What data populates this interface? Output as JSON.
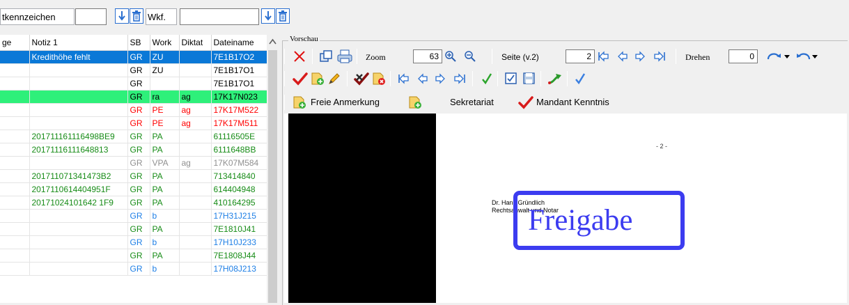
{
  "filters": {
    "field_label": "tkennzeichen",
    "field_value": "",
    "secondary_label": "Wkf.",
    "secondary_value": ""
  },
  "table": {
    "columns": [
      "ge",
      "Notiz 1",
      "SB",
      "Work",
      "Diktat",
      "Dateiname"
    ],
    "rows": [
      {
        "ge": "",
        "notiz": "Kredithöhe fehlt",
        "sb": "GR",
        "work": "ZU",
        "diktat": "",
        "datei": "7E1B17O2",
        "style": "selected"
      },
      {
        "ge": "",
        "notiz": "",
        "sb": "GR",
        "work": "ZU",
        "diktat": "",
        "datei": "7E1B17O1",
        "style": "black"
      },
      {
        "ge": "",
        "notiz": "",
        "sb": "GR",
        "work": "",
        "diktat": "",
        "datei": "7E1B17O1",
        "style": "black"
      },
      {
        "ge": "",
        "notiz": "",
        "sb": "GR",
        "work": "ra",
        "diktat": "ag",
        "datei": "17K17N023",
        "style": "green-bg"
      },
      {
        "ge": "",
        "notiz": "",
        "sb": "GR",
        "work": "PE",
        "diktat": "ag",
        "datei": "17K17M522",
        "style": "red"
      },
      {
        "ge": "",
        "notiz": "",
        "sb": "GR",
        "work": "PE",
        "diktat": "ag",
        "datei": "17K17M511",
        "style": "red"
      },
      {
        "ge": "",
        "notiz": "201711161116498BE9",
        "sb": "GR",
        "work": "PA",
        "diktat": "",
        "datei": "61116505E",
        "style": "green"
      },
      {
        "ge": "",
        "notiz": "20171116111648813",
        "sb": "GR",
        "work": "PA",
        "diktat": "",
        "datei": "6111648BB",
        "style": "green"
      },
      {
        "ge": "",
        "notiz": "",
        "sb": "GR",
        "work": "VPA",
        "diktat": "ag",
        "datei": "17K07M584",
        "style": "gray"
      },
      {
        "ge": "",
        "notiz": "201711071341473B2",
        "sb": "GR",
        "work": "PA",
        "diktat": "",
        "datei": "713414840",
        "style": "green"
      },
      {
        "ge": "",
        "notiz": "2017110614404951F",
        "sb": "GR",
        "work": "PA",
        "diktat": "",
        "datei": "614404948",
        "style": "green"
      },
      {
        "ge": "",
        "notiz": "20171024101642 1F9",
        "sb": "GR",
        "work": "PA",
        "diktat": "",
        "datei": "410164295",
        "style": "green"
      },
      {
        "ge": "",
        "notiz": "",
        "sb": "GR",
        "work": "b",
        "diktat": "",
        "datei": "17H31J215",
        "style": "blue"
      },
      {
        "ge": "",
        "notiz": "",
        "sb": "GR",
        "work": "PA",
        "diktat": "",
        "datei": "7E1810J41",
        "style": "green"
      },
      {
        "ge": "",
        "notiz": "",
        "sb": "GR",
        "work": "b",
        "diktat": "",
        "datei": "17H10J233",
        "style": "blue"
      },
      {
        "ge": "",
        "notiz": "",
        "sb": "GR",
        "work": "PA",
        "diktat": "",
        "datei": "7E1808J44",
        "style": "green"
      },
      {
        "ge": "",
        "notiz": "",
        "sb": "GR",
        "work": "b",
        "diktat": "",
        "datei": "17H08J213",
        "style": "blue"
      }
    ]
  },
  "preview": {
    "legend": "Vorschau",
    "zoom_label": "Zoom",
    "zoom_value": "63",
    "page_label": "Seite (v.2)",
    "page_value": "2",
    "rotate_label": "Drehen",
    "rotate_value": "0",
    "freie_anmerkung": "Freie Anmerkung",
    "sekretariat": "Sekretariat",
    "mandant_kenntnis": "Mandant Kenntnis",
    "document": {
      "page_number": "- 2 -",
      "name_line1": "Dr. Hans Gründlich",
      "name_line2": "Rechtsanwalt und Notar",
      "stamp": "Freigabe"
    }
  },
  "colors": {
    "selection": "#0a78d7",
    "highlight_green": "#2ef07a",
    "stamp_blue": "#3c3cf0"
  }
}
